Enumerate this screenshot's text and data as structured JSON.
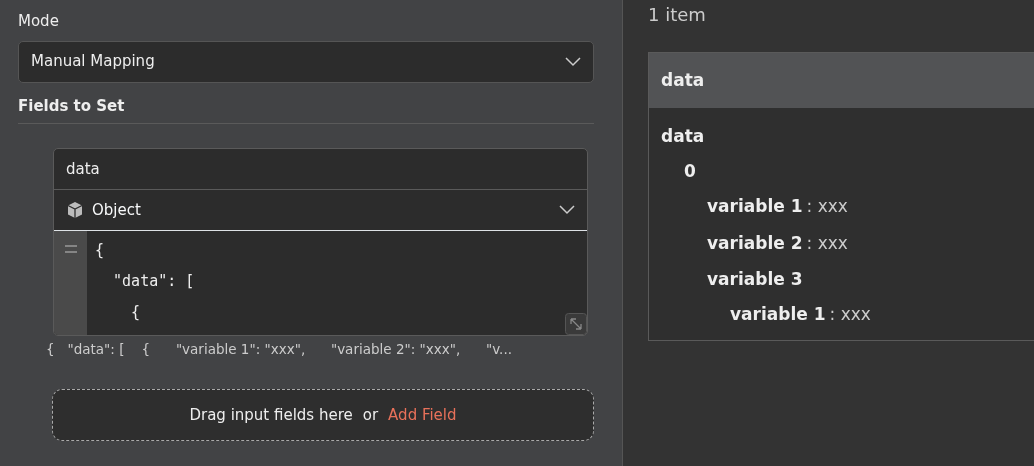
{
  "mode": {
    "label": "Mode",
    "value": "Manual Mapping"
  },
  "fields_section": {
    "title": "Fields to Set"
  },
  "field": {
    "name": "data",
    "type": "Object",
    "code_lines": [
      "{",
      "  \"data\": [",
      "    {"
    ],
    "preview": "{   \"data\": [    {      \"variable 1\": \"xxx\",      \"variable 2\": \"xxx\",      \"v..."
  },
  "drop_zone": {
    "text": "Drag input fields here",
    "separator": "or",
    "link": "Add Field"
  },
  "output": {
    "count": "1 item",
    "header": "data",
    "tree": [
      {
        "key": "data",
        "children": [
          {
            "key": "0",
            "children": [
              {
                "key": "variable 1",
                "value": ": xxx"
              },
              {
                "key": "variable 2",
                "value": ": xxx"
              },
              {
                "key": "variable 3",
                "children": [
                  {
                    "key": "variable 1",
                    "value": ": xxx"
                  }
                ]
              }
            ]
          }
        ]
      }
    ]
  }
}
